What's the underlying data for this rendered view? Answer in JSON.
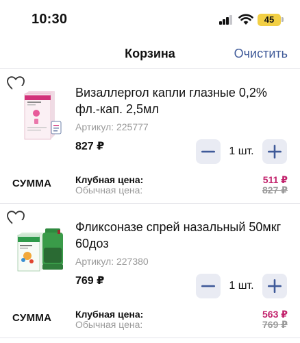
{
  "status": {
    "time": "10:30",
    "battery": "45"
  },
  "header": {
    "title": "Корзина",
    "clear_label": "Очистить"
  },
  "items": [
    {
      "name": "Визаллергол капли глазные 0,2% фл.-кап. 2,5мл",
      "sku": "Артикул: 225777",
      "price": "827 ₽",
      "quantity": "1 шт.",
      "sum_label": "СУММА",
      "club_label": "Клубная цена:",
      "regular_label": "Обычная цена:",
      "club_price": "511 ₽",
      "regular_price": "827 ₽"
    },
    {
      "name": "Фликсоназе спрей назальный 50мкг 60доз",
      "sku": "Артикул: 227380",
      "price": "769 ₽",
      "quantity": "1 шт.",
      "sum_label": "СУММА",
      "club_label": "Клубная цена:",
      "regular_label": "Обычная цена:",
      "club_price": "563 ₽",
      "regular_price": "769 ₽"
    }
  ],
  "colors": {
    "accent_blue": "#3f5a99",
    "club_price": "#c2216b",
    "stepper_bg": "#e9ebf3",
    "stepper_icon": "#3f5a99",
    "battery": "#f2cf44"
  },
  "icons": {
    "favorite": "heart-outline-icon",
    "minus": "minus-icon",
    "plus": "plus-icon",
    "signal": "cellular-signal-icon",
    "wifi": "wifi-icon",
    "battery": "battery-icon"
  }
}
